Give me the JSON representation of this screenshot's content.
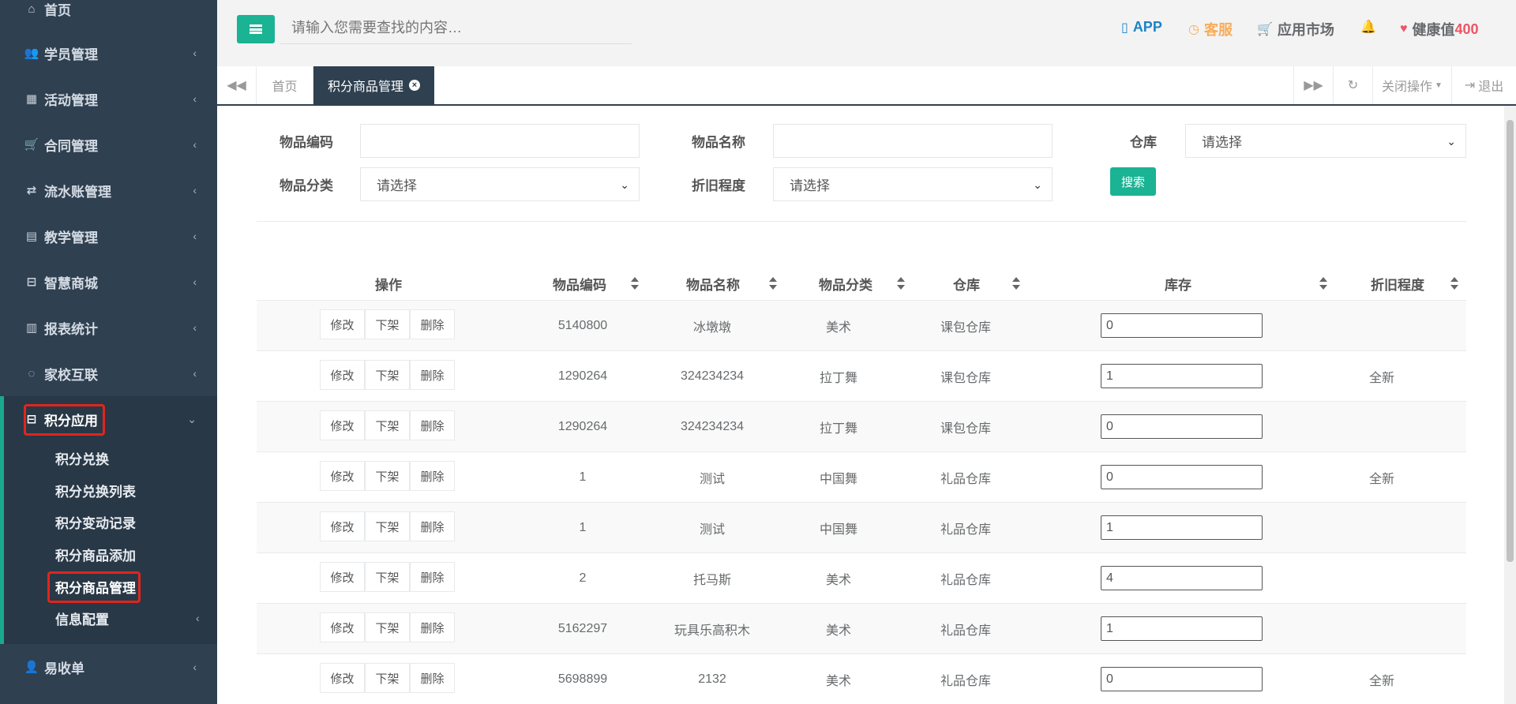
{
  "sidebar": {
    "items": [
      {
        "label": "首页",
        "icon": "home-icon",
        "glyph": "⌂"
      },
      {
        "label": "学员管理",
        "icon": "users-icon",
        "glyph": "👥"
      },
      {
        "label": "活动管理",
        "icon": "map-icon",
        "glyph": "▦"
      },
      {
        "label": "合同管理",
        "icon": "cart-icon",
        "glyph": "🛒"
      },
      {
        "label": "流水账管理",
        "icon": "exchange-icon",
        "glyph": "⇄"
      },
      {
        "label": "教学管理",
        "icon": "calendar-icon",
        "glyph": "▤"
      },
      {
        "label": "智慧商城",
        "icon": "inbox-icon",
        "glyph": "⊟"
      },
      {
        "label": "报表统计",
        "icon": "bar-chart-icon",
        "glyph": "▥"
      },
      {
        "label": "家校互联",
        "icon": "comment-icon",
        "glyph": "◌"
      },
      {
        "label": "积分应用",
        "icon": "inbox-icon",
        "glyph": "⊟"
      },
      {
        "label": "易收单",
        "icon": "user-plus-icon",
        "glyph": "👤"
      }
    ],
    "subitems": [
      {
        "label": "积分兑换"
      },
      {
        "label": "积分兑换列表"
      },
      {
        "label": "积分变动记录"
      },
      {
        "label": "积分商品添加"
      },
      {
        "label": "积分商品管理"
      },
      {
        "label": "信息配置"
      }
    ]
  },
  "topbar": {
    "search_placeholder": "请输入您需要查找的内容…",
    "app_label": "APP",
    "service_label": "客服",
    "market_label": "应用市场",
    "health_label": "健康值",
    "health_value": "400",
    "colors": {
      "app": "#1c84c6",
      "service": "#f8ac59",
      "market": "#676a6c",
      "health": "#ed5565",
      "accent": "#1ab394"
    }
  },
  "tabs": {
    "home": "首页",
    "active": "积分商品管理",
    "close_ops": "关闭操作",
    "logout": "退出"
  },
  "form": {
    "code_label": "物品编码",
    "name_label": "物品名称",
    "warehouse_label": "仓库",
    "category_label": "物品分类",
    "depreciation_label": "折旧程度",
    "select_placeholder": "请选择",
    "search_button": "搜索"
  },
  "table": {
    "headers": [
      "操作",
      "物品编码",
      "物品名称",
      "物品分类",
      "仓库",
      "库存",
      "折旧程度"
    ],
    "action_labels": [
      "修改",
      "下架",
      "删除"
    ],
    "rows": [
      {
        "code": "5140800",
        "name": "冰墩墩",
        "category": "美术",
        "warehouse": "课包仓库",
        "stock": "0",
        "depreciation": ""
      },
      {
        "code": "1290264",
        "name": "324234234",
        "category": "拉丁舞",
        "warehouse": "课包仓库",
        "stock": "1",
        "depreciation": "全新"
      },
      {
        "code": "1290264",
        "name": "324234234",
        "category": "拉丁舞",
        "warehouse": "课包仓库",
        "stock": "0",
        "depreciation": ""
      },
      {
        "code": "1",
        "name": "测试",
        "category": "中国舞",
        "warehouse": "礼品仓库",
        "stock": "0",
        "depreciation": "全新"
      },
      {
        "code": "1",
        "name": "测试",
        "category": "中国舞",
        "warehouse": "礼品仓库",
        "stock": "1",
        "depreciation": ""
      },
      {
        "code": "2",
        "name": "托马斯",
        "category": "美术",
        "warehouse": "礼品仓库",
        "stock": "4",
        "depreciation": ""
      },
      {
        "code": "5162297",
        "name": "玩具乐高积木",
        "category": "美术",
        "warehouse": "礼品仓库",
        "stock": "1",
        "depreciation": ""
      },
      {
        "code": "5698899",
        "name": "2132",
        "category": "美术",
        "warehouse": "礼品仓库",
        "stock": "0",
        "depreciation": "全新"
      }
    ]
  }
}
